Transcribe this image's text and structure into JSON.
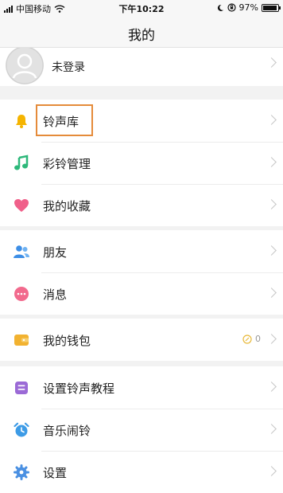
{
  "status_bar": {
    "carrier": "中国移动",
    "time": "下午10:22",
    "battery": "97%",
    "battery_level": 0.97
  },
  "nav": {
    "title": "我的"
  },
  "profile": {
    "name": "未登录"
  },
  "menu": {
    "group1": [
      {
        "label": "铃声库",
        "icon": "bell-icon",
        "color": "#f5b400"
      },
      {
        "label": "彩铃管理",
        "icon": "music-note-icon",
        "color": "#2db87a"
      },
      {
        "label": "我的收藏",
        "icon": "heart-icon",
        "color": "#f0608a"
      }
    ],
    "group2": [
      {
        "label": "朋友",
        "icon": "friends-icon",
        "color": "#3d8ee6"
      },
      {
        "label": "消息",
        "icon": "message-icon",
        "color": "#f26a8d"
      }
    ],
    "group3": [
      {
        "label": "我的钱包",
        "icon": "wallet-icon",
        "color": "#f2b230",
        "badge": "0"
      }
    ],
    "group4": [
      {
        "label": "设置铃声教程",
        "icon": "tutorial-icon",
        "color": "#9b6ad6"
      },
      {
        "label": "音乐闹铃",
        "icon": "alarm-clock-icon",
        "color": "#3d9be6"
      },
      {
        "label": "设置",
        "icon": "settings-icon",
        "color": "#4a90e2"
      }
    ]
  }
}
